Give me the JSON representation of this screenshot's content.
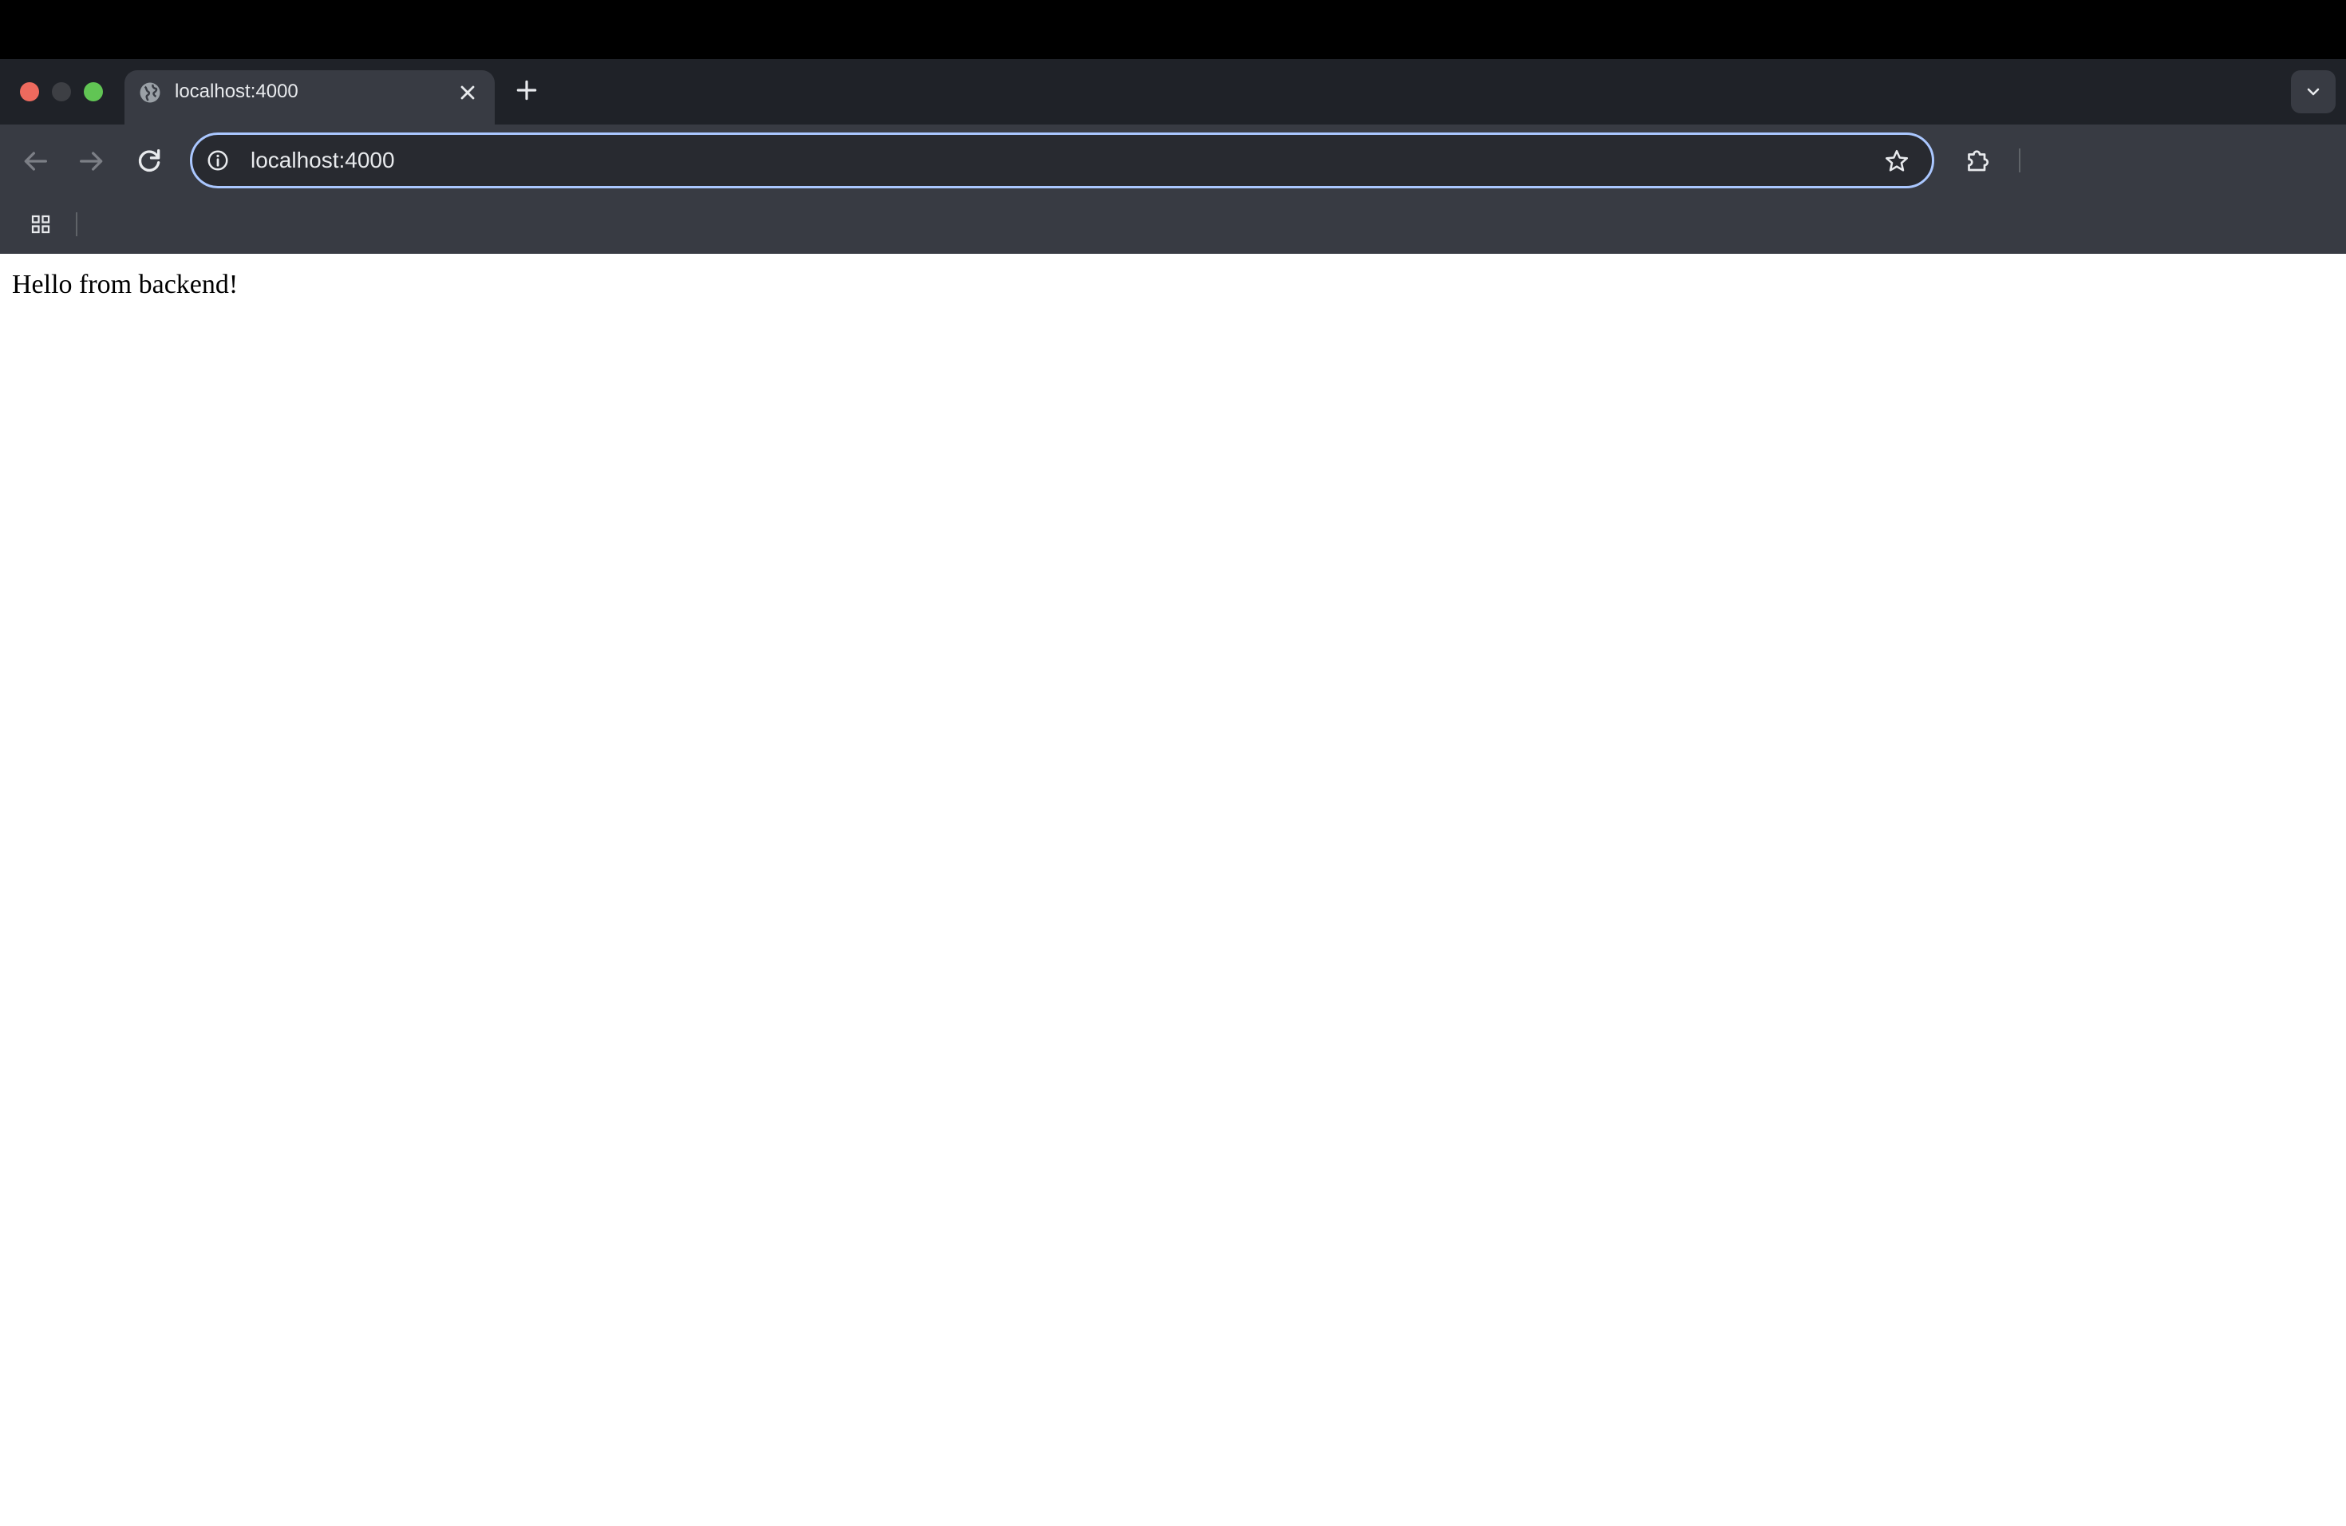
{
  "browser": {
    "tab": {
      "title": "localhost:4000",
      "favicon": "globe-icon"
    },
    "address_bar": {
      "value": "localhost:4000"
    },
    "icons": {
      "back": "arrow-left-icon",
      "forward": "arrow-right-icon",
      "reload": "reload-icon",
      "site_info": "info-icon",
      "bookmark": "star-icon",
      "extensions": "puzzle-icon",
      "apps": "apps-grid-icon",
      "tab_close": "close-icon",
      "new_tab": "plus-icon",
      "tab_search": "chevron-down-icon"
    },
    "colors": {
      "menubar": "#000000",
      "tabstrip": "#1f2228",
      "active_tab": "#383b43",
      "toolbar": "#383b43",
      "omnibox": "#282a30",
      "omnibox_focus_ring": "#aac7ff",
      "traffic_close": "#ed6a5e",
      "traffic_minimize": "#3d3f44",
      "traffic_maximize": "#61c554"
    }
  },
  "page": {
    "body_text": "Hello from backend!"
  }
}
